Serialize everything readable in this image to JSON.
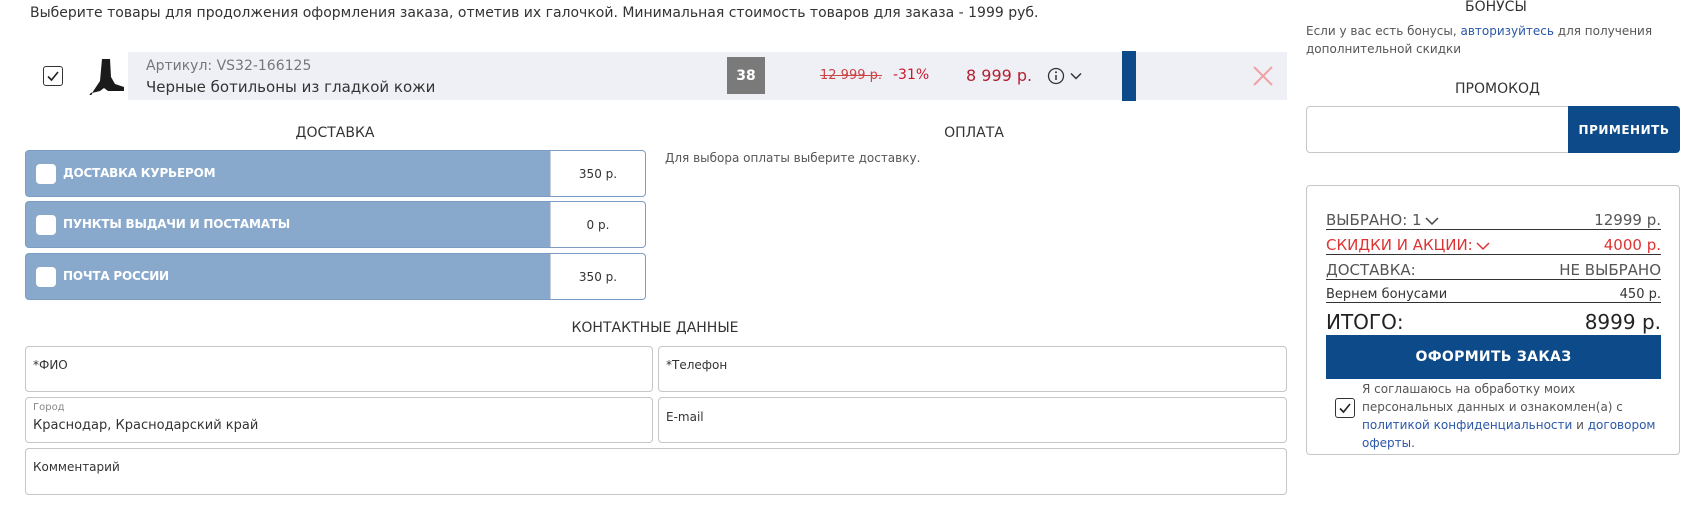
{
  "intro": "Выберите товары для продолжения оформления заказа, отметив их галочкой. Минимальная стоимость товаров для заказа - 1999 руб.",
  "cart_item": {
    "checked": true,
    "article": "Артикул: VS32-166125",
    "name": "Черные ботильоны из гладкой кожи",
    "size": "38",
    "old_price": "12 999 р.",
    "discount": "-31%",
    "price": "8 999 р.",
    "icons": [
      "boot-thumbnail",
      "info-icon",
      "chevron-down-icon",
      "close-icon"
    ]
  },
  "delivery": {
    "title": "ДОСТАВКА",
    "options": [
      {
        "label": "ДОСТАВКА КУРЬЕРОМ",
        "price": "350 р."
      },
      {
        "label": "ПУНКТЫ ВЫДАЧИ И ПОСТАМАТЫ",
        "price": "0 р."
      },
      {
        "label": "ПОЧТА РОССИИ",
        "price": "350 р."
      }
    ]
  },
  "payment": {
    "title": "ОПЛАТА",
    "note": "Для выбора оплаты выберите доставку."
  },
  "contacts": {
    "title": "КОНТАКТНЫЕ ДАННЫЕ",
    "fio_placeholder": "*ФИО",
    "phone_placeholder": "*Телефон",
    "city_label": "Город",
    "city_value": "Краснодар, Краснодарский край",
    "email_placeholder": "E-mail",
    "comment_placeholder": "Комментарий"
  },
  "bonus": {
    "title": "БОНУСЫ",
    "text_before": "Если у вас есть бонусы, ",
    "link": "авторизуйтесь",
    "text_after": " для получения дополнительной скидки"
  },
  "promo": {
    "title": "ПРОМОКОД",
    "button": "ПРИМЕНИТЬ"
  },
  "summary": {
    "selected_label": "ВЫБРАНО: 1",
    "selected_value": "12999 р.",
    "discounts_label": "СКИДКИ И АКЦИИ:",
    "discounts_value": "4000 р.",
    "delivery_label": "ДОСТАВКА:",
    "delivery_value": "НЕ ВЫБРАНО",
    "bonus_back_label": "Вернем бонусами",
    "bonus_back_value": "450 р.",
    "total_label": "ИТОГО:",
    "total_value": "8999 р.",
    "order_button": "ОФОРМИТЬ ЗАКАЗ",
    "agree_checked": true,
    "agree_text": "Я соглашаюсь на обработку моих персональных данных и ознакомлен(а) с ",
    "agree_link1": "политикой конфиденциальности",
    "agree_and": " и ",
    "agree_link2": "договором оферты",
    "agree_end": "."
  },
  "colors": {
    "accent": "#0c4a89",
    "delivery_option": "#88a9cc",
    "price_red": "#b41f2e"
  }
}
